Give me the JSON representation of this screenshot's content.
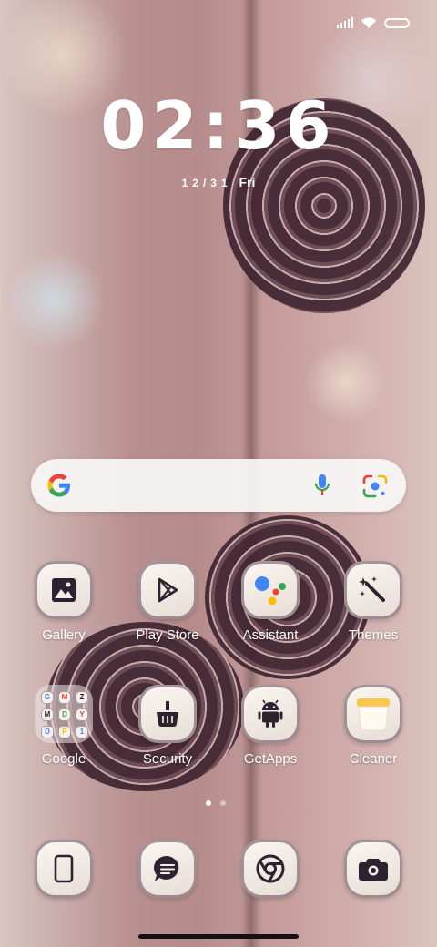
{
  "status_bar": {
    "signal_icon": "cellular-signal-icon",
    "wifi_icon": "wifi-icon",
    "battery_icon": "battery-icon"
  },
  "lock_clock": {
    "time": "02:36",
    "date": "12/31",
    "weekday": "Fri"
  },
  "search_widget": {
    "logo_icon": "google-g-icon",
    "mic_icon": "microphone-icon",
    "lens_icon": "google-lens-icon"
  },
  "apps_row1": [
    {
      "label": "Gallery",
      "icon": "gallery-icon"
    },
    {
      "label": "Play Store",
      "icon": "play-store-icon"
    },
    {
      "label": "Assistant",
      "icon": "assistant-icon"
    },
    {
      "label": "Themes",
      "icon": "magic-wand-icon"
    }
  ],
  "apps_row2": [
    {
      "label": "Google",
      "icon": "folder-icon"
    },
    {
      "label": "Security",
      "icon": "security-broom-icon"
    },
    {
      "label": "GetApps",
      "icon": "android-icon"
    },
    {
      "label": "Cleaner",
      "icon": "cleaner-bin-icon"
    }
  ],
  "google_folder_apps": [
    "G",
    "M",
    "Z",
    "M",
    "D",
    "Y",
    "D",
    "P",
    "1"
  ],
  "dock": [
    {
      "icon": "phone-icon"
    },
    {
      "icon": "messages-icon"
    },
    {
      "icon": "chrome-icon"
    },
    {
      "icon": "camera-icon"
    }
  ],
  "page_indicator": {
    "pages": 2,
    "current": 1
  },
  "colors": {
    "icon_bg": "#f4eee8",
    "icon_fg": "#2b2430",
    "label": "#ffffff",
    "assistant_blue": "#4285F4",
    "assistant_red": "#EA4335",
    "assistant_yellow": "#FBBC05",
    "assistant_green": "#34A853"
  }
}
